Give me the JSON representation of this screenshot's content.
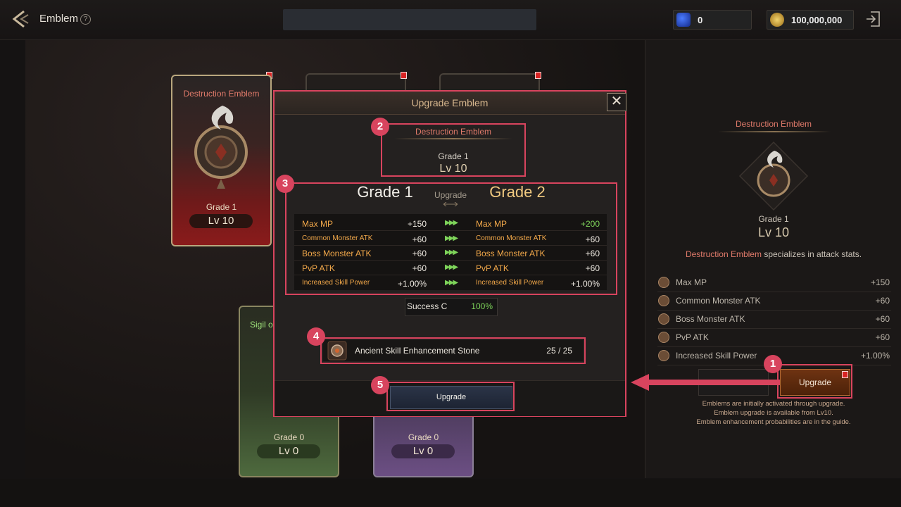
{
  "header": {
    "title": "Emblem",
    "help": "?",
    "gem_count": "0",
    "gold_count": "100,000,000"
  },
  "cards": {
    "destruction": {
      "title": "Destruction Emblem",
      "grade": "Grade 1",
      "level": "Lv 10"
    },
    "sigil": {
      "title": "Sigil o",
      "grade": "Grade 0",
      "level": "Lv 0"
    },
    "purple": {
      "grade": "Grade 0",
      "level": "Lv 0"
    }
  },
  "detail": {
    "name": "Destruction Emblem",
    "grade": "Grade 1",
    "level": "Lv 10",
    "desc_highlight": "Destruction Emblem",
    "desc_rest": " specializes in attack stats.",
    "stats": [
      {
        "name": "Max MP",
        "value": "+150"
      },
      {
        "name": "Common Monster ATK",
        "value": "+60"
      },
      {
        "name": "Boss Monster ATK",
        "value": "+60"
      },
      {
        "name": "PvP ATK",
        "value": "+60"
      },
      {
        "name": "Increased Skill Power",
        "value": "+1.00%"
      }
    ],
    "upgrade_label": "Upgrade",
    "notes": [
      "Emblems are initially activated through upgrade.",
      "Emblem upgrade is available from Lv10.",
      "Emblem enhancement probabilities are in the guide."
    ]
  },
  "modal": {
    "title": "Upgrade Emblem",
    "close": "✕",
    "emblem_name": "Destruction Emblem",
    "grade": "Grade 1",
    "level": "Lv 10",
    "from_grade": "Grade 1",
    "mid_label": "Upgrade",
    "to_grade": "Grade 2",
    "rows": [
      {
        "name": "Max MP",
        "from": "+150",
        "to": "+200",
        "to_up": true
      },
      {
        "name": "Common Monster ATK",
        "from": "+60",
        "to": "+60",
        "to_up": false
      },
      {
        "name": "Boss Monster ATK",
        "from": "+60",
        "to": "+60",
        "to_up": false
      },
      {
        "name": "PvP ATK",
        "from": "+60",
        "to": "+60",
        "to_up": false
      },
      {
        "name": "Increased Skill Power",
        "from": "+1.00%",
        "to": "+1.00%",
        "to_up": false
      }
    ],
    "arrow_glyph": "▶▶▶",
    "success_label": "Success C",
    "success_value": "100%",
    "material_name": "Ancient Skill Enhancement Stone",
    "material_count": "25 / 25",
    "upgrade_label": "Upgrade"
  },
  "callouts": [
    "1",
    "2",
    "3",
    "4",
    "5"
  ],
  "colors": {
    "highlight": "#d8445e",
    "stat_label": "#f2a84a",
    "increase": "#7ed45a",
    "emblem_name": "#e07a6a"
  },
  "icons": [
    "back-arrow-icon",
    "help-icon",
    "blue-gem-icon",
    "gold-coin-icon",
    "exit-icon",
    "close-icon",
    "stat-icon",
    "stone-icon"
  ]
}
